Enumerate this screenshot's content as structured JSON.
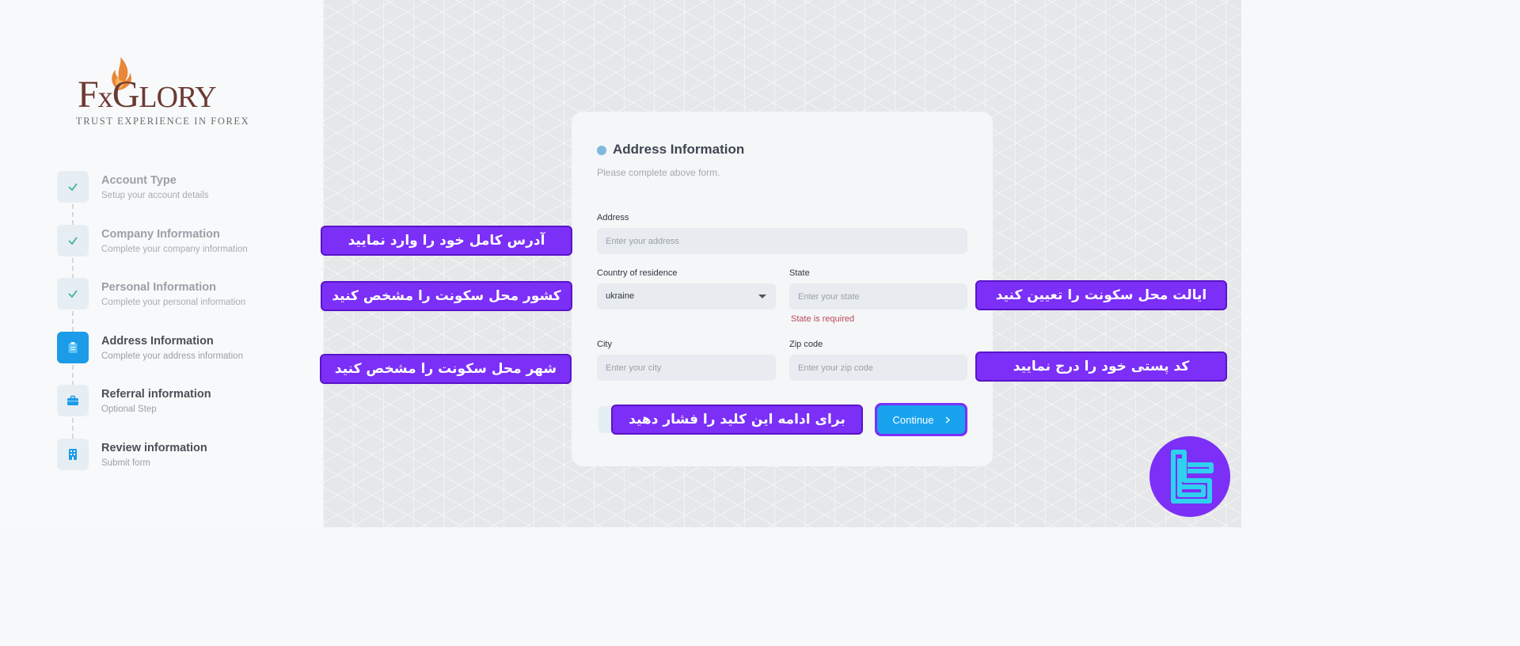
{
  "logo": {
    "brand": "FxGlory",
    "tagline": "TRUST EXPERIENCE IN FOREX"
  },
  "steps": [
    {
      "title": "Account Type",
      "subtitle": "Setup your account details",
      "status": "done"
    },
    {
      "title": "Company Information",
      "subtitle": "Complete your company information",
      "status": "done"
    },
    {
      "title": "Personal Information",
      "subtitle": "Complete your personal information",
      "status": "done"
    },
    {
      "title": "Address Information",
      "subtitle": "Complete your address information",
      "status": "active"
    },
    {
      "title": "Referral information",
      "subtitle": "Optional Step",
      "status": "pending"
    },
    {
      "title": "Review information",
      "subtitle": "Submit form",
      "status": "pending"
    }
  ],
  "form": {
    "title": "Address Information",
    "subtitle": "Please complete above form.",
    "address": {
      "label": "Address",
      "placeholder": "Enter your address",
      "value": ""
    },
    "country": {
      "label": "Country of residence",
      "value": "ukraine"
    },
    "state": {
      "label": "State",
      "placeholder": "Enter your state",
      "value": "",
      "error": "State is required"
    },
    "city": {
      "label": "City",
      "placeholder": "Enter your city",
      "value": ""
    },
    "zip": {
      "label": "Zip code",
      "placeholder": "Enter your zip code",
      "value": ""
    },
    "continue_label": "Continue"
  },
  "callouts": {
    "address": "آدرس کامل خود را وارد نمایید",
    "country": "کشور محل سکونت را مشخص کنید",
    "city": "شهر محل سکونت را مشخص کنید",
    "state": "ایالت محل سکونت را تعیین کنید",
    "zip": "کد پستی خود را درج نمایید",
    "continue": "برای ادامه این کلید را فشار دهید"
  },
  "colors": {
    "accent": "#1b9be8",
    "callout": "#7b2ff7",
    "error": "#b94a5a",
    "brand": "#6b3a33"
  }
}
